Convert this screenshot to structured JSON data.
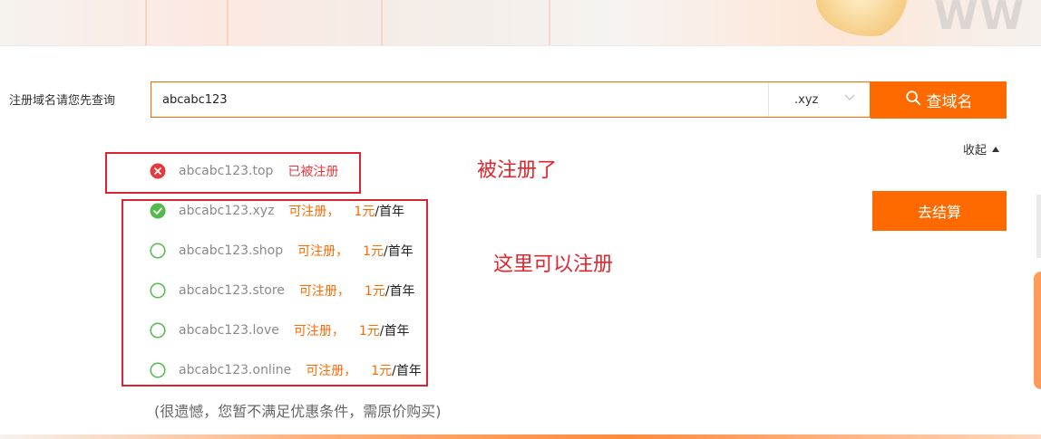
{
  "search": {
    "label": "注册域名请您先查询",
    "value": "abcabc123",
    "tld": ".xyz",
    "button_label": "查域名"
  },
  "collapse_label": "收起",
  "checkout_label": "去结算",
  "results": [
    {
      "domain": "abcabc123.top",
      "status": "已被注册",
      "available": false
    },
    {
      "domain": "abcabc123.xyz",
      "status": "可注册，",
      "price": "1元",
      "unit": "/首年",
      "available": true,
      "selected": true
    },
    {
      "domain": "abcabc123.shop",
      "status": "可注册，",
      "price": "1元",
      "unit": "/首年",
      "available": true,
      "selected": false
    },
    {
      "domain": "abcabc123.store",
      "status": "可注册，",
      "price": "1元",
      "unit": "/首年",
      "available": true,
      "selected": false
    },
    {
      "domain": "abcabc123.love",
      "status": "可注册，",
      "price": "1元",
      "unit": "/首年",
      "available": true,
      "selected": false
    },
    {
      "domain": "abcabc123.online",
      "status": "可注册，",
      "price": "1元",
      "unit": "/首年",
      "available": true,
      "selected": false
    }
  ],
  "annotations": {
    "taken": "被注册了",
    "available": "这里可以注册"
  },
  "notice": "(很遗憾，您暂不满足优惠条件，需原价购买)",
  "colors": {
    "accent": "#ff6a00",
    "taken": "#e8383d",
    "check_green": "#52b94a",
    "annotation_red": "#d9252f"
  },
  "icons": {
    "search": "search-icon",
    "chevron": "chevron-down-icon",
    "taken": "error-circle-icon",
    "selected": "check-circle-icon",
    "unselected": "empty-circle-icon"
  }
}
